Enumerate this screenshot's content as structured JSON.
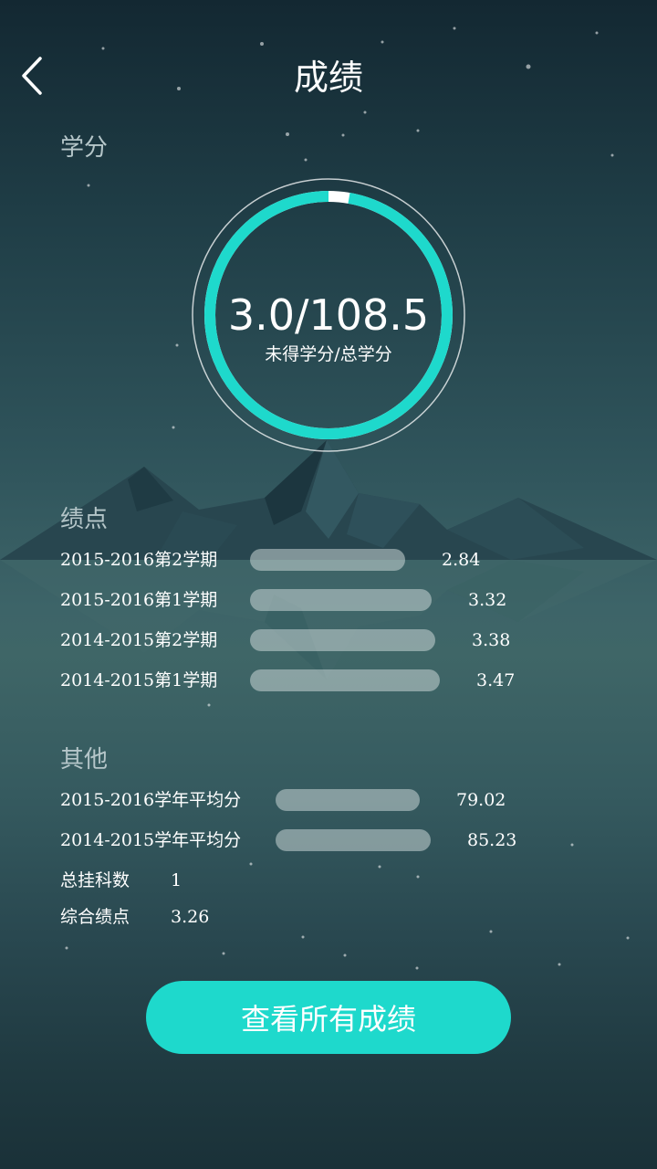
{
  "header": {
    "title": "成绩",
    "back_icon": "chevron-left-icon"
  },
  "credits": {
    "section_title": "学分",
    "value_text": "3.0/108.5",
    "caption": "未得学分/总学分",
    "unearned": 3.0,
    "total": 108.5,
    "ring_color": "#1ed9cc",
    "remainder_color": "#ffffff"
  },
  "gpa": {
    "section_title": "绩点",
    "scale_max": 5.0,
    "items": [
      {
        "label": "2015-2016第2学期",
        "value": "2.84"
      },
      {
        "label": "2015-2016第1学期",
        "value": "3.32"
      },
      {
        "label": "2014-2015第2学期",
        "value": "3.38"
      },
      {
        "label": "2014-2015第1学期",
        "value": "3.47"
      }
    ]
  },
  "other": {
    "section_title": "其他",
    "scale_max": 120,
    "averages": [
      {
        "label": "2015-2016学年平均分",
        "value": "79.02"
      },
      {
        "label": "2014-2015学年平均分",
        "value": "85.23"
      }
    ],
    "stats": [
      {
        "label": "总挂科数",
        "value": "1"
      },
      {
        "label": "综合绩点",
        "value": "3.26"
      }
    ]
  },
  "cta": {
    "label": "查看所有成绩",
    "color": "#1ed9cc"
  }
}
